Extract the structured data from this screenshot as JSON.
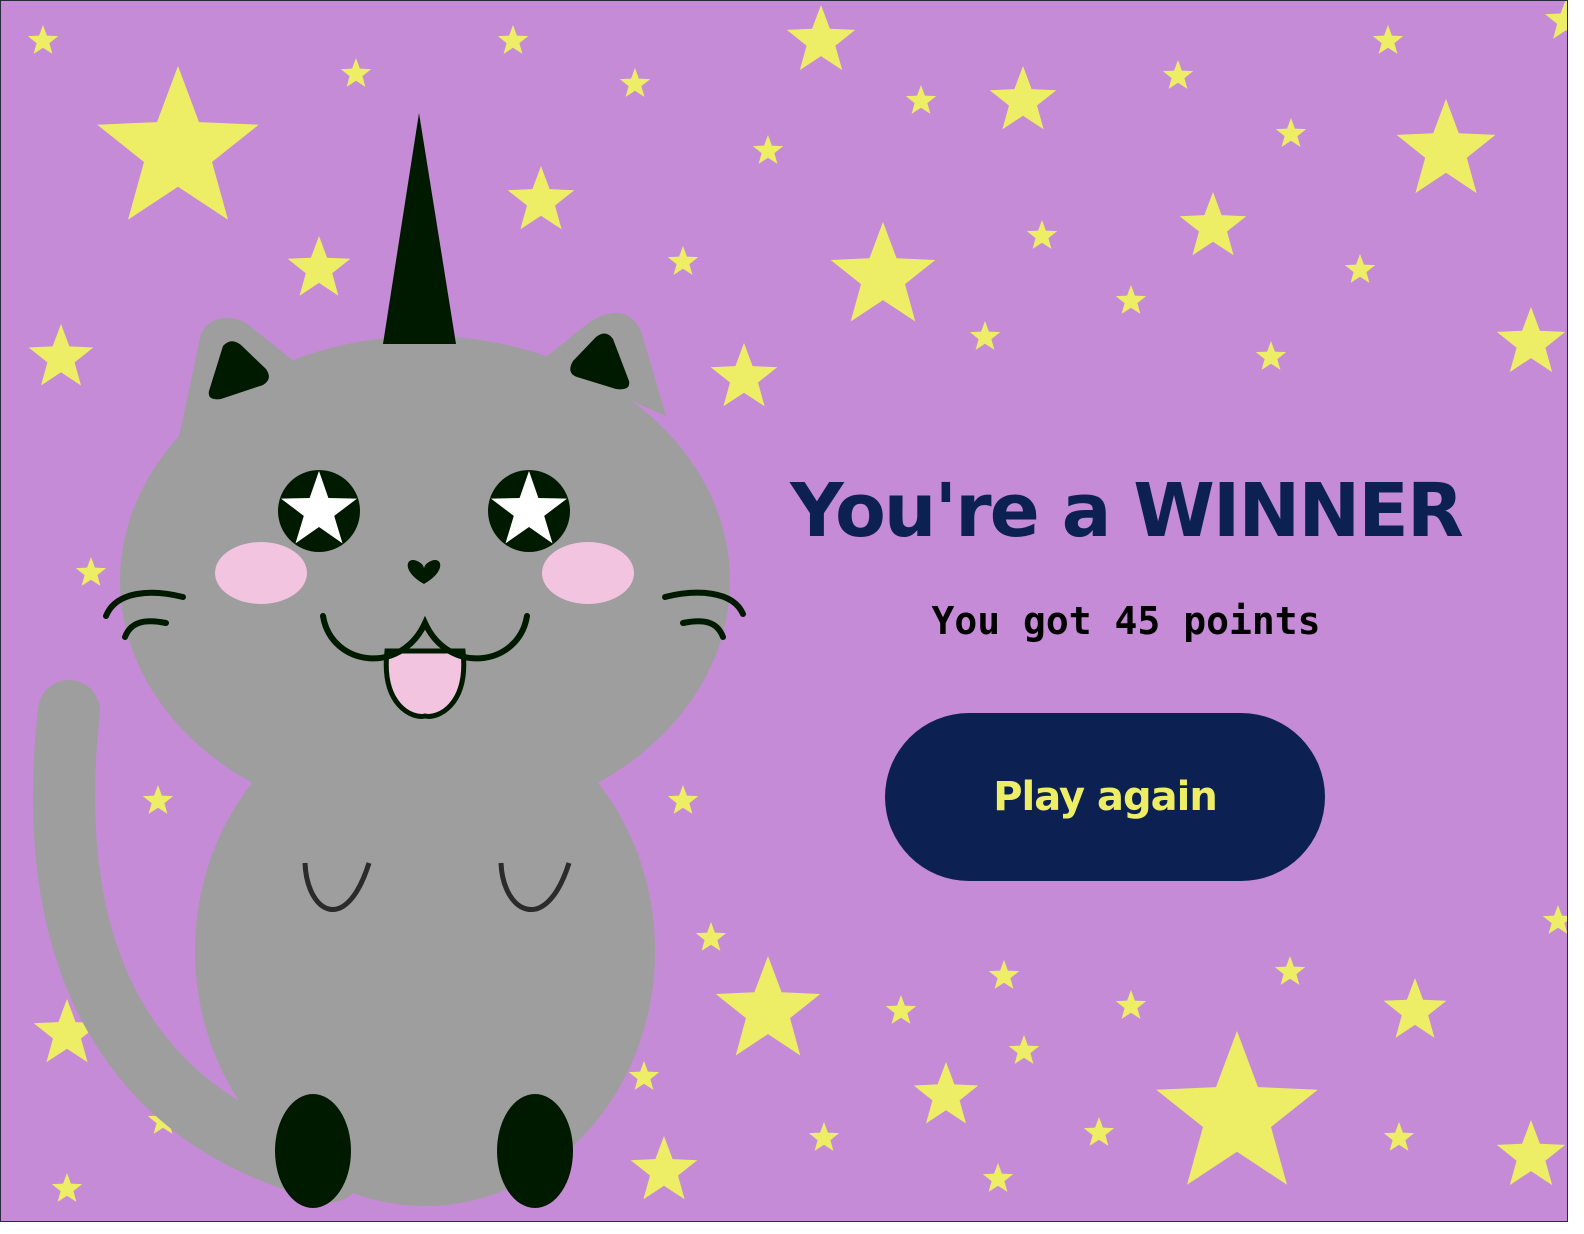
{
  "screen": {
    "background_color": "#c58bd6",
    "star_color": "#eeee66"
  },
  "mascot": {
    "type": "unicorn-cat",
    "body_color": "#9e9e9e",
    "horn_color": "#001a00",
    "cheek_color": "#f2c4e0",
    "eye_icon": "star-icon"
  },
  "result": {
    "title": "You're a WINNER",
    "score_text": "You got 45 points"
  },
  "actions": {
    "play_again_label": "Play again"
  },
  "colors": {
    "title": "#0c2152",
    "button_bg": "#0c2152",
    "button_text": "#eeee66"
  }
}
